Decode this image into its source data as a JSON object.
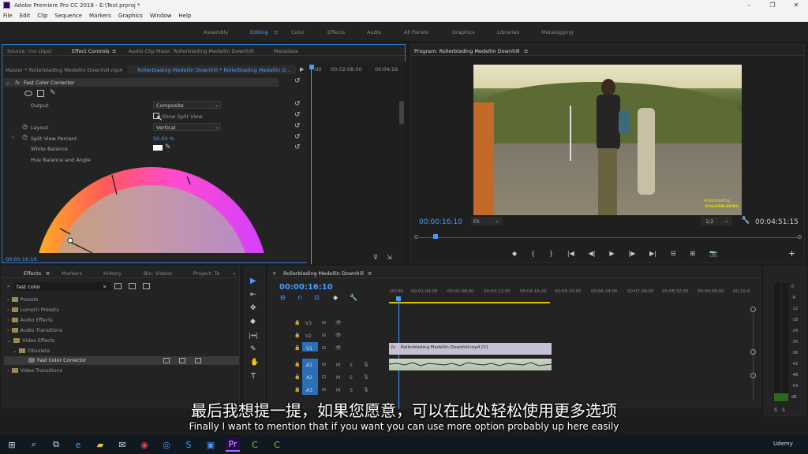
{
  "window": {
    "title": "Adobe Premiere Pro CC 2018 - E:\\Test.prproj *",
    "min": "–",
    "max": "❐",
    "close": "✕"
  },
  "menu": [
    "File",
    "Edit",
    "Clip",
    "Sequence",
    "Markers",
    "Graphics",
    "Window",
    "Help"
  ],
  "workspaces": [
    "Assembly",
    "Editing",
    "Color",
    "Effects",
    "Audio",
    "All Panels",
    "Graphics",
    "Libraries",
    "Metalogging"
  ],
  "workspace_menu": "≡",
  "effect_controls": {
    "tabs": [
      "Source: (no clips)",
      "Effect Controls",
      "Audio Clip Mixer: Rollerblading Medellin Downhill",
      "Metadata"
    ],
    "tab_menu": "≡",
    "master": "Master * Rollerblading Medellin Downhill.mp4",
    "sequence_clip": "Rollerblading Medellin Downhill * Rollerblading Medellin D...",
    "ruler": [
      ":00",
      "00:02:08:00",
      "00:04:16"
    ],
    "fx": "fx",
    "effect_name": "Fast Color Corrector",
    "output_label": "Output",
    "output_value": "Composite",
    "split_view_label": "Show Split View",
    "layout_label": "Layout",
    "layout_value": "Vertical",
    "split_percent_label": "Split View Percent",
    "split_percent_value": "50.00 %",
    "white_balance_label": "White Balance",
    "hue_label": "Hue Balance and Angle",
    "timecode": "00:00:16:10"
  },
  "program": {
    "title": "Program: Rollerblading Medellin Downhill",
    "title_menu": "≡",
    "timecode": "00:00:16:10",
    "fit": "Fit",
    "quality": "1/2",
    "duration": "00:04:51:15",
    "watermark_top": "Rollerblading",
    "watermark": "ROLLERBLADING",
    "controls": [
      "◆",
      "{",
      "}",
      "|◀",
      "◀|",
      "▶",
      "|▶",
      "▶|",
      "⊟",
      "⊞",
      "📷"
    ],
    "add": "+"
  },
  "effects": {
    "tabs": [
      "Effects",
      "Markers",
      "History",
      "Bin: Videos",
      "Project: Te"
    ],
    "tab_menu": "≡",
    "overflow": "»",
    "search": "fast color",
    "clear": "✕",
    "tree": [
      "Presets",
      "Lumetri Presets",
      "Audio Effects",
      "Audio Transitions",
      "Video Effects",
      "Obsolete",
      "Fast Color Corrector",
      "Video Transitions"
    ]
  },
  "tools": [
    "▶",
    "⇤",
    "✥",
    "◆",
    "|↔|",
    "✎",
    "✋",
    "T"
  ],
  "timeline": {
    "close": "✕",
    "title": "Rollerblading Medellin Downhill",
    "title_menu": "≡",
    "timecode": "00:00:16:10",
    "ruler": [
      ":00:00",
      "00:01:04:00",
      "00:02:08:00",
      "00:03:12:00",
      "00:04:16:00",
      "00:05:20:00",
      "00:06:24:00",
      "00:07:28:00",
      "00:08:32:00",
      "00:09:36:00",
      "00:10:4"
    ],
    "tracks": [
      "V3",
      "V2",
      "V1",
      "A1",
      "A2",
      "A3"
    ],
    "mute": "M",
    "solo": "S",
    "clip_label": "Rollerblading Medellin Downhill.mp4 [V]"
  },
  "meter": {
    "labels": [
      "0",
      "-6",
      "-12",
      "-18",
      "-24",
      "-30",
      "-36",
      "-42",
      "-48",
      "-54",
      "dB"
    ],
    "solo": "S"
  },
  "subtitles": {
    "cn": "最后我想提一提，如果您愿意，可以在此处轻松使用更多选项",
    "en": "Finally I want to mention that if you want you can use more option probably up here easily"
  },
  "taskbar": {
    "udemy": "Udemy"
  }
}
